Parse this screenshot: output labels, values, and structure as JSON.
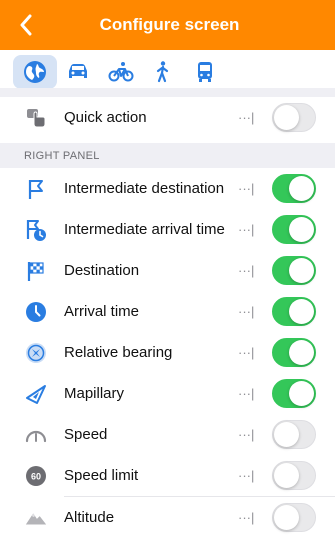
{
  "header": {
    "title": "Configure screen"
  },
  "colors": {
    "accent": "#ff8800",
    "blue": "#2a7de1",
    "toggle_on": "#34c759",
    "toggle_off": "#e9e9eb"
  },
  "modes": [
    {
      "icon": "globe-icon",
      "active": true
    },
    {
      "icon": "car-icon",
      "active": false
    },
    {
      "icon": "bicycle-icon",
      "active": false
    },
    {
      "icon": "pedestrian-icon",
      "active": false
    },
    {
      "icon": "bus-icon",
      "active": false
    }
  ],
  "quick_action": {
    "label": "Quick action",
    "dots": "···|",
    "enabled": false,
    "icon": "quick-action-hand-icon"
  },
  "right_panel": {
    "header": "RIGHT PANEL",
    "items": [
      {
        "label": "Intermediate destination",
        "dots": "···|",
        "enabled": true,
        "icon": "flag-icon"
      },
      {
        "label": "Intermediate arrival time",
        "dots": "···|",
        "enabled": true,
        "icon": "flag-clock-icon"
      },
      {
        "label": "Destination",
        "dots": "···|",
        "enabled": true,
        "icon": "checkered-flag-icon"
      },
      {
        "label": "Arrival time",
        "dots": "···|",
        "enabled": true,
        "icon": "clock-icon"
      },
      {
        "label": "Relative bearing",
        "dots": "···|",
        "enabled": true,
        "icon": "relative-bearing-icon"
      },
      {
        "label": "Mapillary",
        "dots": "···|",
        "enabled": true,
        "icon": "mapillary-icon"
      },
      {
        "label": "Speed",
        "dots": "···|",
        "enabled": false,
        "icon": "speedometer-icon"
      },
      {
        "label": "Speed limit",
        "dots": "···|",
        "enabled": false,
        "icon": "speed-limit-icon",
        "icon_text": "60"
      },
      {
        "label": "Altitude",
        "dots": "···|",
        "enabled": false,
        "icon": "mountain-icon"
      }
    ]
  }
}
